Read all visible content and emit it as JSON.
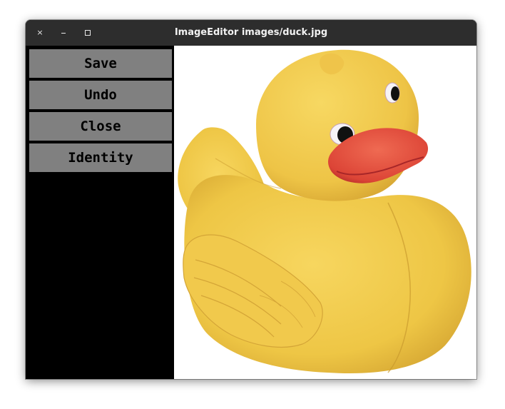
{
  "window": {
    "title": "ImageEditor images/duck.jpg",
    "close_glyph": "×",
    "controls": [
      "close-icon",
      "minimize-icon",
      "maximize-icon"
    ]
  },
  "sidebar": {
    "buttons": [
      {
        "label": "Save"
      },
      {
        "label": "Undo"
      },
      {
        "label": "Close"
      },
      {
        "label": "Identity"
      }
    ]
  },
  "image": {
    "file": "images/duck.jpg",
    "subject": "yellow rubber duck",
    "colors": {
      "background": "#ffffff",
      "duck_body": "#f3cc4e",
      "duck_shadow": "#d9a933",
      "beak": "#e04a3a",
      "beak_dark": "#b52a2a"
    }
  }
}
